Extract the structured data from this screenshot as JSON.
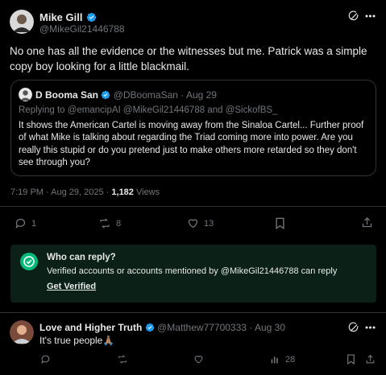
{
  "main_tweet": {
    "author_name": "Mike Gill",
    "author_handle": "@MikeGil21446788",
    "text": "No one has all the evidence or the witnesses but me.  Patrick was a simple copy boy looking for a little blackmail.",
    "timestamp": "7:19 PM · Aug 29, 2025",
    "separator": "·",
    "views_count": "1,182",
    "views_label": "Views",
    "replies": "1",
    "reposts": "8",
    "likes": "13"
  },
  "quoted_tweet": {
    "author_name": "D Booma San",
    "author_handle": "@DBoomaSan",
    "date": "· Aug 29",
    "replying_prefix": "Replying to ",
    "replying_to": "@emancipAI @MikeGil21446788",
    "replying_and": " and ",
    "replying_to_2": "@SickofBS_",
    "text": "It shows the American Cartel is moving away from the Sinaloa Cartel... Further proof of what Mike is talking about regarding the Triad coming more into power. Are you really this stupid or do you pretend just to make others more retarded so they don't see through you?"
  },
  "reply_restriction": {
    "title": "Who can reply?",
    "description": "Verified accounts or accounts mentioned by @MikeGil21446788 can reply",
    "cta": "Get Verified"
  },
  "reply_tweet": {
    "author_name": "Love and Higher Truth",
    "author_handle": "@Matthew77700333",
    "date": "· Aug 30",
    "text": "It's true people🙏🏽",
    "views": "28"
  },
  "colors": {
    "background": "#000000",
    "text": "#e7e9ea",
    "muted": "#71767b",
    "verified": "#1d9bf0",
    "panel_bg": "#0b2118",
    "panel_icon": "#00ba7c",
    "border": "#2f3336"
  }
}
